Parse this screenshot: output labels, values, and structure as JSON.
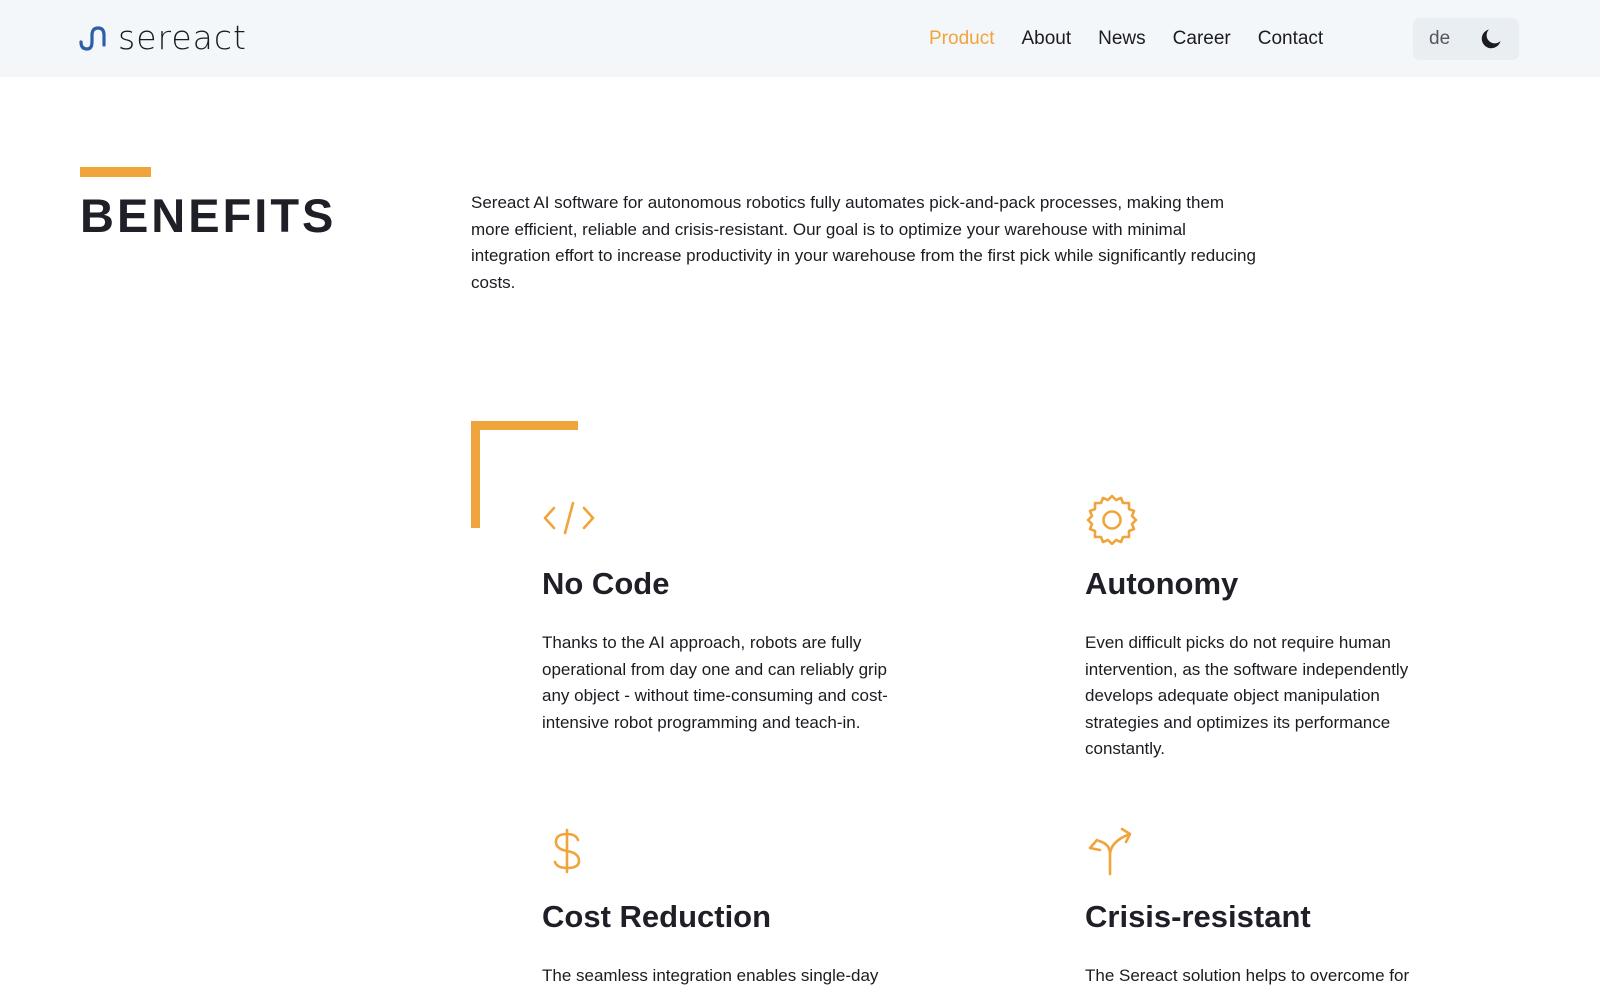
{
  "header": {
    "logo_text": "sereact",
    "nav": [
      "Product",
      "About",
      "News",
      "Career",
      "Contact"
    ],
    "active_nav": "Product",
    "language": "de",
    "theme_icon": "moon-icon"
  },
  "colors": {
    "accent": "#f0a43c",
    "header_bg": "#f4f7fa",
    "text": "#1b1b22",
    "logo_blue": "#2d5fa8"
  },
  "benefits": {
    "title": "BENEFITS",
    "intro": "Sereact AI software for autonomous robotics fully automates pick-and-pack processes, making them more efficient, reliable and crisis-resistant. Our goal is to optimize your warehouse with minimal integration effort to increase productivity in your warehouse from the first pick while significantly reducing costs.",
    "items": [
      {
        "icon": "code-icon",
        "title": "No Code",
        "text": "Thanks to the AI approach, robots are fully operational from day one and can reliably grip any object - without time-consuming and cost-intensive robot programming and teach-in."
      },
      {
        "icon": "gear-icon",
        "title": "Autonomy",
        "text": "Even difficult picks do not require human intervention, as the software independently develops adequate object manipulation strategies and optimizes its performance constantly."
      },
      {
        "icon": "dollar-icon",
        "title": "Cost Reduction",
        "text": "The seamless integration enables single-day"
      },
      {
        "icon": "split-arrow-icon",
        "title": "Crisis-resistant",
        "text": "The Sereact solution helps to overcome for"
      }
    ]
  }
}
